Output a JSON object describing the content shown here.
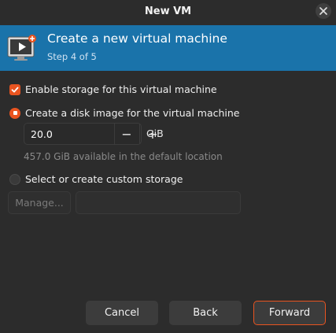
{
  "window": {
    "title": "New VM"
  },
  "banner": {
    "title": "Create a new virtual machine",
    "step": "Step 4 of 5",
    "icon": "monitor-icon"
  },
  "storage": {
    "enable_label": "Enable storage for this virtual machine",
    "enable_checked": true,
    "disk_image_label": "Create a disk image for the virtual machine",
    "disk_image_selected": true,
    "size_value": "20.0",
    "size_unit": "GiB",
    "available_text": "457.0 GiB available in the default location",
    "custom_label": "Select or create custom storage",
    "custom_selected": false,
    "manage_label": "Manage...",
    "custom_path": ""
  },
  "buttons": {
    "cancel": "Cancel",
    "back": "Back",
    "forward": "Forward"
  },
  "colors": {
    "accent": "#e95420",
    "banner": "#1a73aa",
    "background": "#2c2c2c"
  }
}
